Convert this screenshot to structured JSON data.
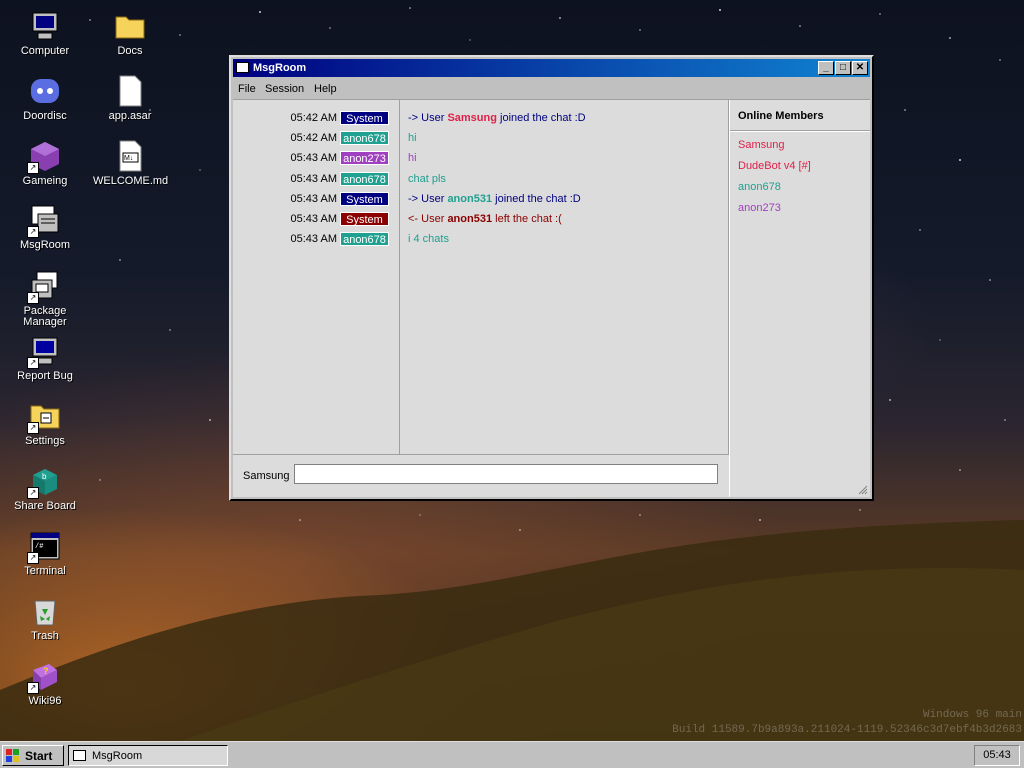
{
  "desktop": {
    "icons": [
      {
        "label": "Computer",
        "icon": "computer-icon"
      },
      {
        "label": "Docs",
        "icon": "folder-icon"
      },
      {
        "label": "Doordisc",
        "icon": "discord-icon"
      },
      {
        "label": "app.asar",
        "icon": "file-icon"
      },
      {
        "label": "Gameing",
        "icon": "game-cube-icon"
      },
      {
        "label": "WELCOME.md",
        "icon": "markdown-file-icon"
      },
      {
        "label": "MsgRoom",
        "icon": "msgroom-icon"
      },
      {
        "label": "Package Manager",
        "icon": "package-manager-icon"
      },
      {
        "label": "Report Bug",
        "icon": "report-bug-icon"
      },
      {
        "label": "Settings",
        "icon": "settings-icon"
      },
      {
        "label": "Share Board",
        "icon": "share-board-icon"
      },
      {
        "label": "Terminal",
        "icon": "terminal-icon"
      },
      {
        "label": "Trash",
        "icon": "recycle-bin-icon"
      },
      {
        "label": "Wiki96",
        "icon": "wiki-book-icon"
      }
    ]
  },
  "window": {
    "title": "MsgRoom",
    "menu": [
      "File",
      "Session",
      "Help"
    ],
    "messages": [
      {
        "time": "05:42 AM",
        "user": "System",
        "badge_color": "#000080",
        "parts": [
          "-> User ",
          "Samsung",
          " joined the chat :D"
        ],
        "text_color": "#000080",
        "name_color": "#e0204a"
      },
      {
        "time": "05:42 AM",
        "user": "anon678",
        "badge_color": "#20a090",
        "text": "hi",
        "text_color": "#20a090"
      },
      {
        "time": "05:43 AM",
        "user": "anon273",
        "badge_color": "#a040c0",
        "text": "hi",
        "text_color": "#a040c0"
      },
      {
        "time": "05:43 AM",
        "user": "anon678",
        "badge_color": "#20a090",
        "text": "chat pls",
        "text_color": "#20a090"
      },
      {
        "time": "05:43 AM",
        "user": "System",
        "badge_color": "#000080",
        "parts": [
          "-> User ",
          "anon531",
          " joined the chat :D"
        ],
        "text_color": "#000080",
        "name_color": "#20a090"
      },
      {
        "time": "05:43 AM",
        "user": "System",
        "badge_color": "#8b0000",
        "parts": [
          "<- User ",
          "anon531",
          " left the chat :("
        ],
        "text_color": "#8b0000",
        "name_color": "#8b0000"
      },
      {
        "time": "05:43 AM",
        "user": "anon678",
        "badge_color": "#20a090",
        "text": "i 4 chats",
        "text_color": "#20a090"
      }
    ],
    "members_title": "Online Members",
    "members": [
      {
        "name": "Samsung",
        "color": "#e0204a"
      },
      {
        "name": "DudeBot v4 [#]",
        "color": "#e0204a"
      },
      {
        "name": "anon678",
        "color": "#20a090"
      },
      {
        "name": "anon273",
        "color": "#a040c0"
      }
    ],
    "input_label": "Samsung",
    "input_value": ""
  },
  "watermark": {
    "line1": "Windows 96 main",
    "line2": "Build 11589.7b9a893a.211024-1119.52346c3d7ebf4b3d2683"
  },
  "taskbar": {
    "start_label": "Start",
    "task_label": "MsgRoom",
    "clock": "05:43"
  }
}
